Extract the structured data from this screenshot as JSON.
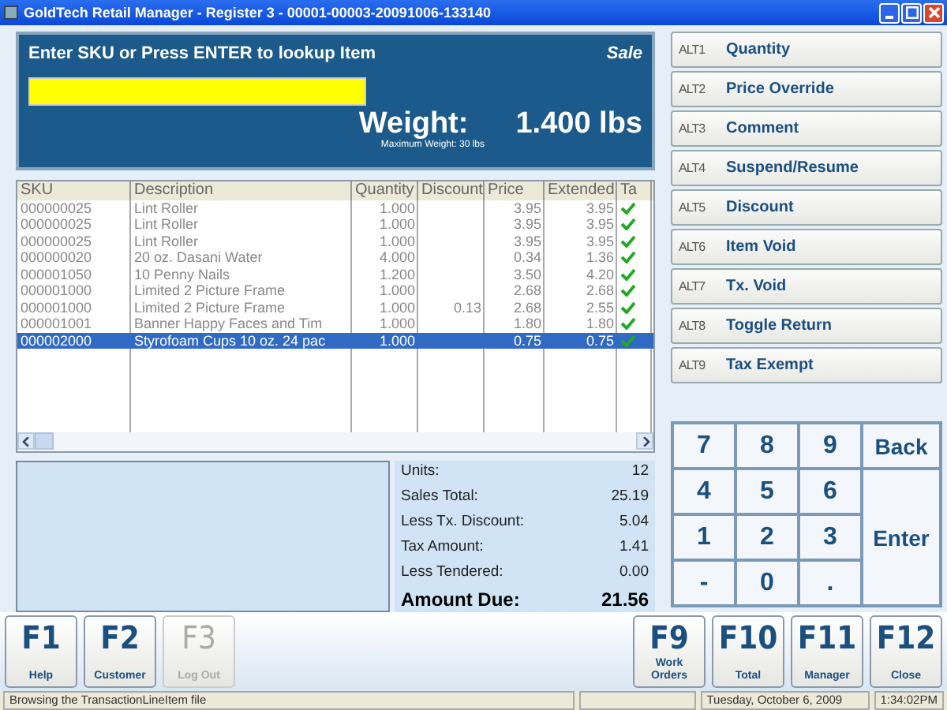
{
  "window": {
    "title": "GoldTech Retail Manager - Register 3 - 00001-00003-20091006-133140"
  },
  "entry": {
    "prompt": "Enter SKU or Press ENTER to lookup Item",
    "mode": "Sale",
    "weight_label": "Weight:",
    "weight_value": "1.400  lbs",
    "max_weight": "Maximum Weight: 30 lbs"
  },
  "table": {
    "columns": [
      "SKU",
      "Description",
      "Quantity",
      "Discount",
      "Price",
      "Extended",
      "Ta"
    ],
    "rows": [
      {
        "sku": "000000025",
        "description": "Lint Roller",
        "quantity": "1.000",
        "discount": "",
        "price": "3.95",
        "extended": "3.95",
        "taxed": true,
        "selected": false
      },
      {
        "sku": "000000025",
        "description": "Lint Roller",
        "quantity": "1.000",
        "discount": "",
        "price": "3.95",
        "extended": "3.95",
        "taxed": true,
        "selected": false
      },
      {
        "sku": "000000025",
        "description": "Lint Roller",
        "quantity": "1.000",
        "discount": "",
        "price": "3.95",
        "extended": "3.95",
        "taxed": true,
        "selected": false
      },
      {
        "sku": "000000020",
        "description": "20 oz. Dasani Water",
        "quantity": "4.000",
        "discount": "",
        "price": "0.34",
        "extended": "1.36",
        "taxed": true,
        "selected": false
      },
      {
        "sku": "000001050",
        "description": "10 Penny Nails",
        "quantity": "1.200",
        "discount": "",
        "price": "3.50",
        "extended": "4.20",
        "taxed": true,
        "selected": false
      },
      {
        "sku": "000001000",
        "description": "Limited 2 Picture Frame",
        "quantity": "1.000",
        "discount": "",
        "price": "2.68",
        "extended": "2.68",
        "taxed": true,
        "selected": false
      },
      {
        "sku": "000001000",
        "description": "Limited 2 Picture Frame",
        "quantity": "1.000",
        "discount": "0.13",
        "price": "2.68",
        "extended": "2.55",
        "taxed": true,
        "selected": false
      },
      {
        "sku": "000001001",
        "description": "Banner Happy Faces and Tim",
        "quantity": "1.000",
        "discount": "",
        "price": "1.80",
        "extended": "1.80",
        "taxed": true,
        "selected": false
      },
      {
        "sku": "000002000",
        "description": "Styrofoam Cups 10 oz. 24 pac",
        "quantity": "1.000",
        "discount": "",
        "price": "0.75",
        "extended": "0.75",
        "taxed": true,
        "selected": true
      }
    ]
  },
  "totals": [
    {
      "label": "Units:",
      "value": "12",
      "kind": "normal"
    },
    {
      "label": "Sales Total:",
      "value": "25.19",
      "kind": "normal"
    },
    {
      "label": "Less Tx. Discount:",
      "value": "5.04",
      "kind": "normal"
    },
    {
      "label": "Tax Amount:",
      "value": "1.41",
      "kind": "normal"
    },
    {
      "label": "Less Tendered:",
      "value": "0.00",
      "kind": "normal"
    },
    {
      "label": "Amount Due:",
      "value": "21.56",
      "kind": "total"
    }
  ],
  "actions": [
    {
      "key": "ALT1",
      "label": "Quantity"
    },
    {
      "key": "ALT2",
      "label": "Price Override"
    },
    {
      "key": "ALT3",
      "label": "Comment"
    },
    {
      "key": "ALT4",
      "label": "Suspend/Resume"
    },
    {
      "key": "ALT5",
      "label": "Discount"
    },
    {
      "key": "ALT6",
      "label": "Item Void"
    },
    {
      "key": "ALT7",
      "label": "Tx. Void"
    },
    {
      "key": "ALT8",
      "label": "Toggle Return"
    },
    {
      "key": "ALT9",
      "label": "Tax Exempt"
    }
  ],
  "keypad": [
    {
      "label": "7",
      "kind": "digit"
    },
    {
      "label": "8",
      "kind": "digit"
    },
    {
      "label": "9",
      "kind": "digit"
    },
    {
      "label": "Back",
      "kind": "word"
    },
    {
      "label": "4",
      "kind": "digit"
    },
    {
      "label": "5",
      "kind": "digit"
    },
    {
      "label": "6",
      "kind": "digit"
    },
    {
      "label": "1",
      "kind": "digit"
    },
    {
      "label": "2",
      "kind": "digit"
    },
    {
      "label": "3",
      "kind": "digit"
    },
    {
      "label": "Enter",
      "kind": "tall"
    },
    {
      "label": "-",
      "kind": "digit"
    },
    {
      "label": "0",
      "kind": "digit"
    },
    {
      "label": ".",
      "kind": "digit"
    }
  ],
  "function_keys_left": [
    {
      "key": "F1",
      "caption": "Help",
      "disabled": false
    },
    {
      "key": "F2",
      "caption": "Customer",
      "disabled": false
    },
    {
      "key": "F3",
      "caption": "Log Out",
      "disabled": true
    }
  ],
  "function_keys_right": [
    {
      "key": "F9",
      "caption": "Work Orders",
      "disabled": false
    },
    {
      "key": "F10",
      "caption": "Total",
      "disabled": false
    },
    {
      "key": "F11",
      "caption": "Manager",
      "disabled": false
    },
    {
      "key": "F12",
      "caption": "Close",
      "disabled": false
    }
  ],
  "status_bar": {
    "message": "Browsing the TransactionLineItem file",
    "date": "Tuesday, October  6, 2009",
    "time": "1:34:02PM"
  }
}
